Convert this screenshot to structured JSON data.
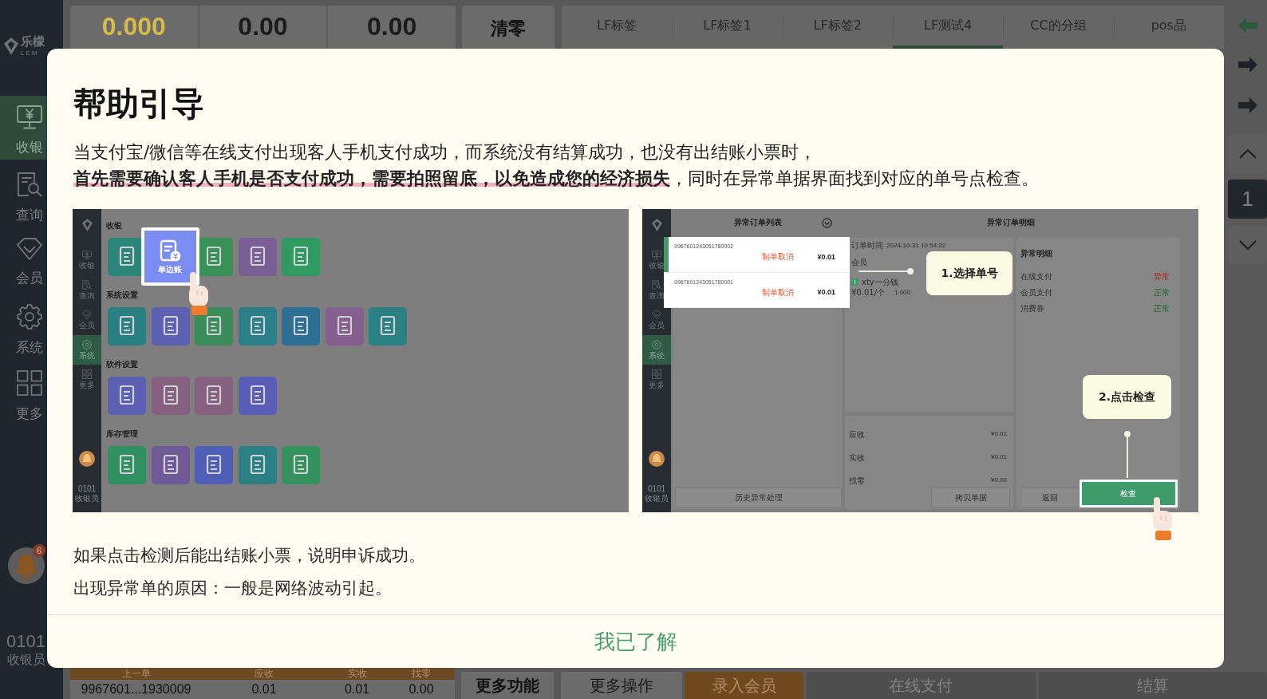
{
  "sidebar": {
    "logo": {
      "name": "乐檬",
      "subtitle": "LEM"
    },
    "items": [
      {
        "label": "收银",
        "selected": true
      },
      {
        "label": "查询",
        "selected": false
      },
      {
        "label": "会员",
        "selected": false
      },
      {
        "label": "系统",
        "selected": false
      },
      {
        "label": "更多",
        "selected": false
      }
    ],
    "notification_count": "6",
    "user": {
      "code": "0101",
      "role": "收银员"
    }
  },
  "top_bar": {
    "readouts": [
      {
        "kind": "weight",
        "value": "0.000"
      },
      {
        "kind": "price",
        "value": "0.00"
      },
      {
        "kind": "amount",
        "value": "0.00"
      }
    ],
    "clear_button": "清零",
    "tabs": [
      {
        "label": "LF标签",
        "selected": false
      },
      {
        "label": "LF标签1",
        "selected": false
      },
      {
        "label": "LF标签2",
        "selected": false
      },
      {
        "label": "LF测试4",
        "selected": true
      },
      {
        "label": "CC的分组",
        "selected": false
      },
      {
        "label": "pos品",
        "selected": false
      }
    ]
  },
  "side_rail": {
    "page": "1"
  },
  "bottom_bar": {
    "last_order": {
      "columns": [
        "上一单",
        "应收",
        "实收",
        "找零"
      ],
      "row": [
        "9967601...1930009",
        "0.01",
        "0.01",
        "0.00"
      ]
    },
    "more_functions": "更多功能",
    "buttons": [
      {
        "kind": "plain",
        "label": "更多操作"
      },
      {
        "kind": "accent",
        "label": "录入会员"
      },
      {
        "kind": "muted",
        "label": "在线支付"
      },
      {
        "kind": "muted",
        "label": "结算"
      }
    ]
  },
  "dialog": {
    "title": "帮助引导",
    "intro": [
      "当支付宝/微信等在线支付出现客人手机支付成功，而系统没有结算成功，也没有出结账小票时，",
      "**首先需要确认客人手机是否支付成功，需要拍照留底，以免造成您的经济损失**，同时在异常单据界面找到对应的单号点检查。"
    ],
    "guide_images": [
      {
        "kind": "function_menu",
        "nav": [
          {
            "label": "收银",
            "selected": false
          },
          {
            "label": "查询",
            "selected": false
          },
          {
            "label": "会员",
            "selected": false
          },
          {
            "label": "系统",
            "selected": true
          },
          {
            "label": "更多",
            "selected": false
          }
        ],
        "user_code": "0101",
        "user_role": "收银员",
        "sections": [
          {
            "title": "收银",
            "tiles": [
              {
                "color": "#2b8578",
                "highlighted": false
              },
              {
                "color": "#7b8cf2",
                "highlighted": true,
                "label": "单边账"
              },
              {
                "color": "#3a9158",
                "highlighted": false
              },
              {
                "color": "#7a5f94",
                "highlighted": false
              },
              {
                "color": "#2f9a62",
                "highlighted": false
              }
            ]
          },
          {
            "title": "系统设置",
            "tiles": [
              {
                "color": "#2a8080",
                "highlighted": false
              },
              {
                "color": "#5d5fb0",
                "highlighted": false
              },
              {
                "color": "#3a8c5a",
                "highlighted": false
              },
              {
                "color": "#2a7f88",
                "highlighted": false
              },
              {
                "color": "#2b6f92",
                "highlighted": false
              },
              {
                "color": "#85608f",
                "highlighted": false
              },
              {
                "color": "#2a8082",
                "highlighted": false
              }
            ]
          },
          {
            "title": "软件设置",
            "tiles": [
              {
                "color": "#5d5fb0",
                "highlighted": false
              },
              {
                "color": "#86607f",
                "highlighted": false
              },
              {
                "color": "#86607f",
                "highlighted": false
              },
              {
                "color": "#5a5cb5",
                "highlighted": false
              }
            ]
          },
          {
            "title": "库存管理",
            "tiles": [
              {
                "color": "#2f9062",
                "highlighted": false
              },
              {
                "color": "#6f5a98",
                "highlighted": false
              },
              {
                "color": "#4f5fb8",
                "highlighted": false
              },
              {
                "color": "#2a8082",
                "highlighted": false
              },
              {
                "color": "#33925e",
                "highlighted": false
              }
            ]
          }
        ]
      },
      {
        "kind": "abnormal_orders",
        "nav": [
          {
            "label": "收银",
            "selected": false
          },
          {
            "label": "查询",
            "selected": false
          },
          {
            "label": "会员",
            "selected": false
          },
          {
            "label": "系统",
            "selected": true
          },
          {
            "label": "更多",
            "selected": false
          }
        ],
        "user_code": "0101",
        "user_role": "收银员",
        "list_title": "异常订单列表",
        "detail_title": "异常订单明细",
        "orders": [
          {
            "number": "9967601243051780002",
            "status": "制单取消",
            "amount": "¥0.01",
            "selected": true
          },
          {
            "number": "9967601243051780001",
            "status": "制单取消",
            "amount": "¥0.01",
            "selected": false
          }
        ],
        "order_time_label": "订单时间",
        "order_time": "2024-10-31 10:54:22",
        "member_label": "会员",
        "product": {
          "name": "xty一分钱",
          "price": "¥0.01/个",
          "quantity": "1.000"
        },
        "summary": [
          {
            "label": "应收",
            "value": "¥0.01"
          },
          {
            "label": "实收",
            "value": "¥0.01"
          },
          {
            "label": "找零",
            "value": "¥0.00"
          }
        ],
        "detail": {
          "title": "异常明细",
          "rows": [
            {
              "label": "在线支付",
              "status": "异常",
              "kind": "error"
            },
            {
              "label": "会员支付",
              "status": "正常",
              "kind": "ok"
            },
            {
              "label": "消费券",
              "status": "正常",
              "kind": "ok"
            }
          ]
        },
        "history_button": "历史异常处理",
        "copy_button": "拷贝单据",
        "back_button": "返回",
        "check_button": "检查",
        "steps": [
          "1.选择单号",
          "2.点击检查"
        ]
      }
    ],
    "notes": [
      "如果点击检测后能出结账小票，说明申诉成功。",
      "出现异常单的原因：一般是网络波动引起。"
    ],
    "confirm_button": "我已了解"
  }
}
